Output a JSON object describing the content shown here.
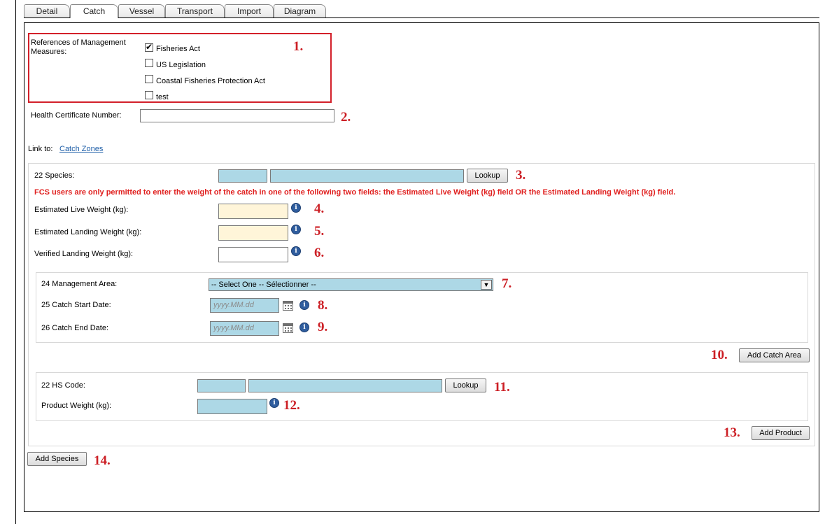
{
  "tabs": [
    "Detail",
    "Catch",
    "Vessel",
    "Transport",
    "Import",
    "Diagram"
  ],
  "active_tab": "Catch",
  "management": {
    "label": "References of Management Measures:",
    "options": [
      {
        "label": "Fisheries Act",
        "checked": true
      },
      {
        "label": "US Legislation",
        "checked": false
      },
      {
        "label": "Coastal Fisheries Protection Act",
        "checked": false
      },
      {
        "label": "test",
        "checked": false
      }
    ]
  },
  "health_cert": {
    "label": "Health Certificate Number:",
    "value": ""
  },
  "link_to": {
    "label": "Link to:",
    "link": "Catch Zones"
  },
  "species": {
    "label": "22 Species:",
    "lookup": "Lookup",
    "warning": "FCS users are only permitted to enter the weight of the catch in one of the following two fields: the Estimated Live Weight (kg) field OR the Estimated Landing Weight (kg) field.",
    "est_live_label": "Estimated Live Weight (kg):",
    "est_landing_label": "Estimated Landing Weight (kg):",
    "verified_label": "Verified Landing Weight (kg):"
  },
  "catch_area": {
    "mgmt_label": "24 Management Area:",
    "mgmt_selected": "-- Select One -- Sélectionner --",
    "start_label": "25 Catch Start Date:",
    "end_label": "26 Catch End Date:",
    "date_placeholder": "yyyy.MM.dd",
    "add_button": "Add Catch Area"
  },
  "product": {
    "hs_label": "22 HS Code:",
    "lookup": "Lookup",
    "weight_label": "Product Weight (kg):",
    "add_button": "Add Product"
  },
  "add_species": "Add Species",
  "markers": [
    "1.",
    "2.",
    "3.",
    "4.",
    "5.",
    "6.",
    "7.",
    "8.",
    "9.",
    "10.",
    "11.",
    "12.",
    "13.",
    "14."
  ],
  "colors": {
    "accent_red": "#cc1f25",
    "field_blue": "#add8e6",
    "field_yellow": "#fff5d9",
    "link": "#1f5fa8"
  }
}
